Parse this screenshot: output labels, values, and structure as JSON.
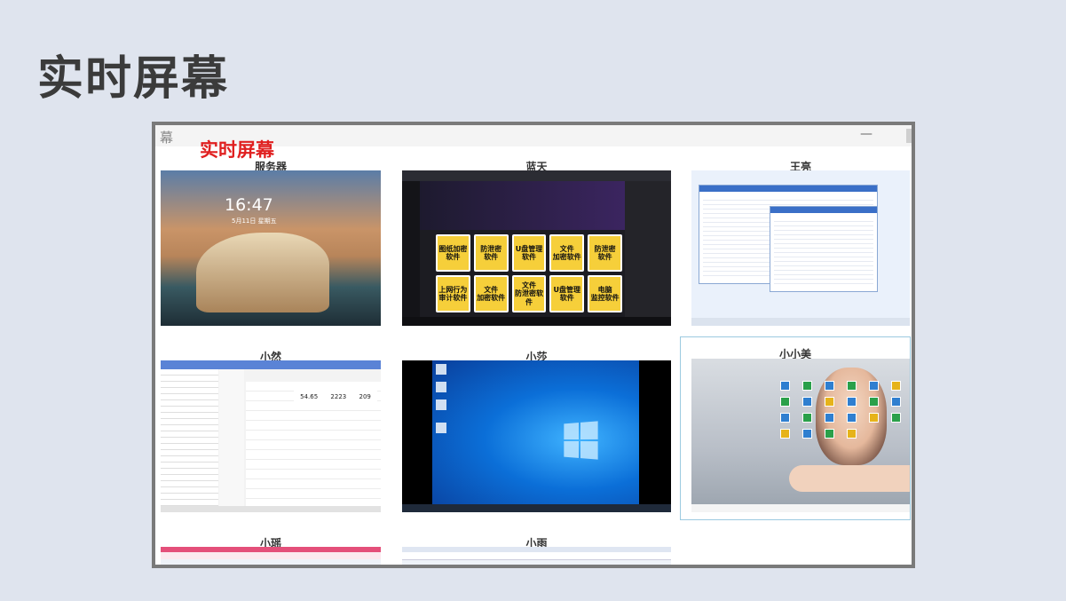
{
  "page": {
    "title": "实时屏幕"
  },
  "window": {
    "heading": "实时屏幕",
    "app_icon_glyph": "幕",
    "minimize_glyph": "—"
  },
  "tiles": [
    {
      "label": "服务器",
      "screen": "lockscreen",
      "clock": "16:47",
      "date": "5月11日 星期五"
    },
    {
      "label": "蓝天",
      "screen": "browser",
      "cards": [
        "图纸加密\n软件",
        "防泄密\n软件",
        "U盘管理\n软件",
        "文件\n加密软件",
        "防泄密\n软件",
        "上网行为\n审计软件",
        "文件\n加密软件",
        "文件\n防泄密软件",
        "U盘管理\n软件",
        "电脑\n监控软件"
      ]
    },
    {
      "label": "王亮",
      "screen": "file-explorer"
    },
    {
      "label": "小然",
      "screen": "article",
      "stats": [
        "54.65",
        "2223",
        "209"
      ]
    },
    {
      "label": "小莎",
      "screen": "windows-desktop"
    },
    {
      "label": "小小美",
      "screen": "portrait-wallpaper",
      "selected": true
    },
    {
      "label": "小瑶",
      "screen": "browser-pink"
    },
    {
      "label": "小雨",
      "screen": "browser-light"
    }
  ],
  "colors": {
    "background": "#dfe4ee",
    "window_frame": "#7a7a7a",
    "heading_red": "#e02020",
    "selection": "#9ccae0"
  }
}
